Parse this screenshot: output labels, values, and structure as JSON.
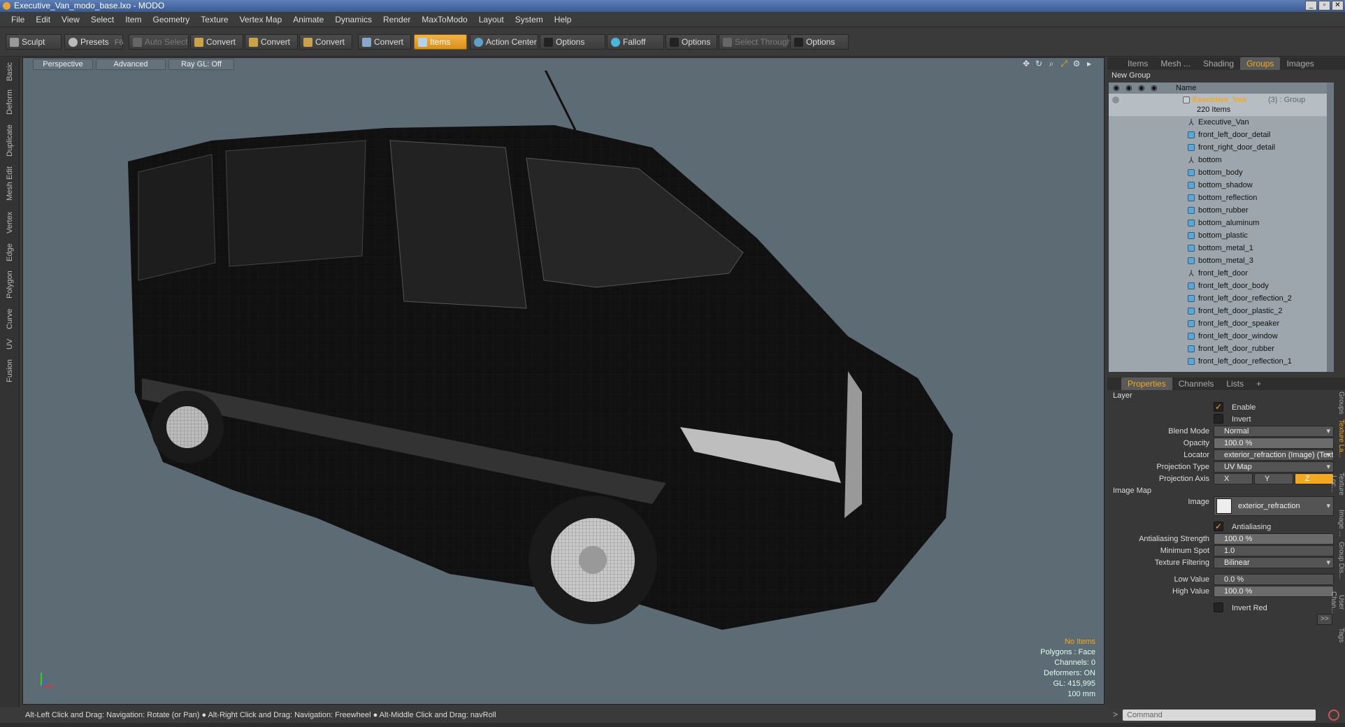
{
  "window": {
    "title": "Executive_Van_modo_base.lxo - MODO",
    "controls": [
      "_",
      "▫",
      "✕"
    ]
  },
  "menu": [
    "File",
    "Edit",
    "View",
    "Select",
    "Item",
    "Geometry",
    "Texture",
    "Vertex Map",
    "Animate",
    "Dynamics",
    "Render",
    "MaxToModo",
    "Layout",
    "System",
    "Help"
  ],
  "toolbar": {
    "sculpt": "Sculpt",
    "presets": "Presets",
    "presets_key": "F6",
    "auto_select": "Auto Select",
    "convert1": "Convert",
    "convert2": "Convert",
    "convert3": "Convert",
    "convert4": "Convert",
    "items": "Items",
    "action_center": "Action Center",
    "options1": "Options",
    "falloff": "Falloff",
    "options2": "Options",
    "select_through": "Select Through",
    "options3": "Options"
  },
  "left_tabs": [
    "Basic",
    "Deform",
    "Duplicate",
    "Mesh Edit",
    "Vertex",
    "Edge",
    "Polygon",
    "Curve",
    "UV",
    "Fusion"
  ],
  "viewport": {
    "view": "Perspective",
    "shading": "Advanced",
    "raygl": "Ray GL: Off",
    "info": {
      "items": "No Items",
      "polygons": "Polygons : Face",
      "channels": "Channels: 0",
      "deformers": "Deformers: ON",
      "gl": "GL: 415,995",
      "scale": "100 mm"
    }
  },
  "top_tabs": [
    "Items",
    "Mesh ...",
    "Shading",
    "Groups",
    "Images"
  ],
  "groups": {
    "new_group": "New Group",
    "col_name": "Name",
    "root": "Executive_Van",
    "root_suffix": "(3) : Group",
    "root_count": "220 Items",
    "items": [
      {
        "name": "Executive_Van",
        "kind": "locator"
      },
      {
        "name": "front_left_door_detail",
        "kind": "mesh"
      },
      {
        "name": "front_right_door_detail",
        "kind": "mesh"
      },
      {
        "name": "bottom",
        "kind": "locator"
      },
      {
        "name": "bottom_body",
        "kind": "mesh"
      },
      {
        "name": "bottom_shadow",
        "kind": "mesh"
      },
      {
        "name": "bottom_reflection",
        "kind": "mesh"
      },
      {
        "name": "bottom_rubber",
        "kind": "mesh"
      },
      {
        "name": "bottom_aluminum",
        "kind": "mesh"
      },
      {
        "name": "bottom_plastic",
        "kind": "mesh"
      },
      {
        "name": "bottom_metal_1",
        "kind": "mesh"
      },
      {
        "name": "bottom_metal_3",
        "kind": "mesh"
      },
      {
        "name": "front_left_door",
        "kind": "locator"
      },
      {
        "name": "front_left_door_body",
        "kind": "mesh"
      },
      {
        "name": "front_left_door_reflection_2",
        "kind": "mesh"
      },
      {
        "name": "front_left_door_plastic_2",
        "kind": "mesh"
      },
      {
        "name": "front_left_door_speaker",
        "kind": "mesh"
      },
      {
        "name": "front_left_door_window",
        "kind": "mesh"
      },
      {
        "name": "front_left_door_rubber",
        "kind": "mesh"
      },
      {
        "name": "front_left_door_reflection_1",
        "kind": "mesh"
      }
    ]
  },
  "prop_tabs": [
    "Properties",
    "Channels",
    "Lists"
  ],
  "properties": {
    "layer": "Layer",
    "enable": "Enable",
    "invert": "Invert",
    "blend_mode_label": "Blend Mode",
    "blend_mode": "Normal",
    "opacity_label": "Opacity",
    "opacity": "100.0 %",
    "locator_label": "Locator",
    "locator": "exterior_refraction (Image) (Text...",
    "proj_type_label": "Projection Type",
    "proj_type": "UV Map",
    "proj_axis_label": "Projection Axis",
    "axis_x": "X",
    "axis_y": "Y",
    "axis_z": "Z",
    "image_map": "Image Map",
    "image_label": "Image",
    "image": "exterior_refraction",
    "antialiasing": "Antialiasing",
    "aa_strength_label": "Antialiasing Strength",
    "aa_strength": "100.0 %",
    "min_spot_label": "Minimum Spot",
    "min_spot": "1.0",
    "tex_filter_label": "Texture Filtering",
    "tex_filter": "Bilinear",
    "low_label": "Low Value",
    "low": "0.0 %",
    "high_label": "High Value",
    "high": "100.0 %",
    "invert_red": "Invert Red",
    "more": ">>"
  },
  "side_tabs": [
    "Groups",
    "Texture La...",
    "Texture Loc...",
    "Image ...",
    "Group Dis...",
    "User Chan...",
    "Tags"
  ],
  "status": "Alt-Left Click and Drag: Navigation: Rotate (or Pan) ● Alt-Right Click and Drag: Navigation: Freewheel ● Alt-Middle Click and Drag: navRoll",
  "command_placeholder": "Command",
  "colors": {
    "accent": "#f3a821",
    "viewport_bg": "#5d6b75"
  }
}
